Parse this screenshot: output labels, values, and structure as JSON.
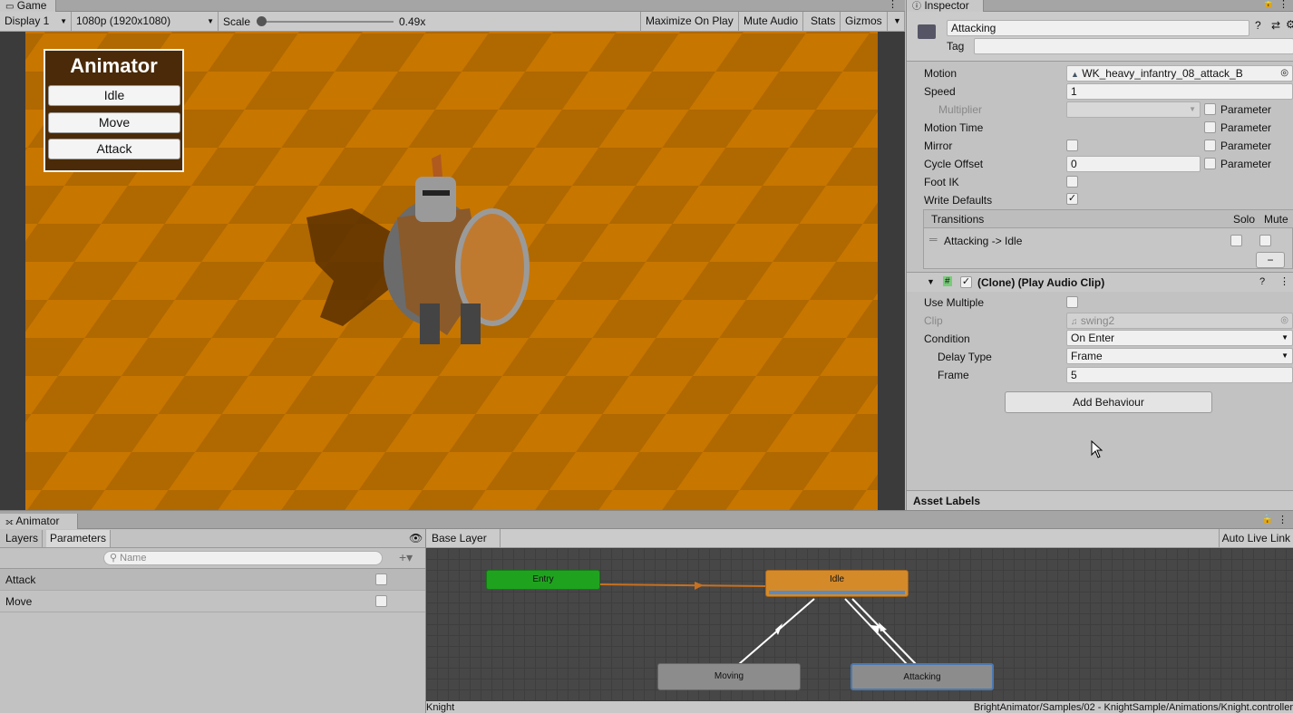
{
  "game": {
    "tab": "Game",
    "display": "Display 1",
    "resolution": "1080p (1920x1080)",
    "scale_label": "Scale",
    "scale_value": "0.49x",
    "scale_level": 0.49,
    "maximize": "Maximize On Play",
    "mute": "Mute Audio",
    "stats": "Stats",
    "gizmos": "Gizmos",
    "floor_color": "#c77600",
    "floor_dark": "#b06800"
  },
  "overlay": {
    "title": "Animator",
    "buttons": [
      "Idle",
      "Move",
      "Attack"
    ]
  },
  "inspector": {
    "tab": "Inspector",
    "name": "Attacking",
    "tag_label": "Tag",
    "motion_label": "Motion",
    "motion_value": "WK_heavy_infantry_08_attack_B",
    "speed_label": "Speed",
    "speed_value": "1",
    "multiplier_label": "Multiplier",
    "motion_time_label": "Motion Time",
    "mirror_label": "Mirror",
    "cycle_offset_label": "Cycle Offset",
    "cycle_offset_value": "0",
    "foot_ik_label": "Foot IK",
    "write_defaults_label": "Write Defaults",
    "parameter_label": "Parameter",
    "transitions_label": "Transitions",
    "solo_label": "Solo",
    "mute_label": "Mute",
    "transition_item": "Attacking -> Idle",
    "minus": "−",
    "component_title": "(Clone) (Play Audio Clip)",
    "use_multiple_label": "Use Multiple",
    "clip_label": "Clip",
    "clip_value": "swing2",
    "condition_label": "Condition",
    "condition_value": "On Enter",
    "delay_type_label": "Delay Type",
    "delay_type_value": "Frame",
    "frame_label": "Frame",
    "frame_value": "5",
    "add_behaviour": "Add Behaviour",
    "asset_labels": "Asset Labels"
  },
  "animator": {
    "tab": "Animator",
    "layers_tab": "Layers",
    "parameters_tab": "Parameters",
    "search_placeholder": "Name",
    "params": [
      {
        "name": "Attack"
      },
      {
        "name": "Move"
      }
    ],
    "breadcrumb": "Base Layer",
    "auto_live_link": "Auto Live Link",
    "nodes": {
      "entry": "Entry",
      "idle": "Idle",
      "moving": "Moving",
      "attacking": "Attacking"
    },
    "status_left": "Knight",
    "status_right": "BrightAnimator/Samples/02 - KnightSample/Animations/Knight.controller"
  }
}
